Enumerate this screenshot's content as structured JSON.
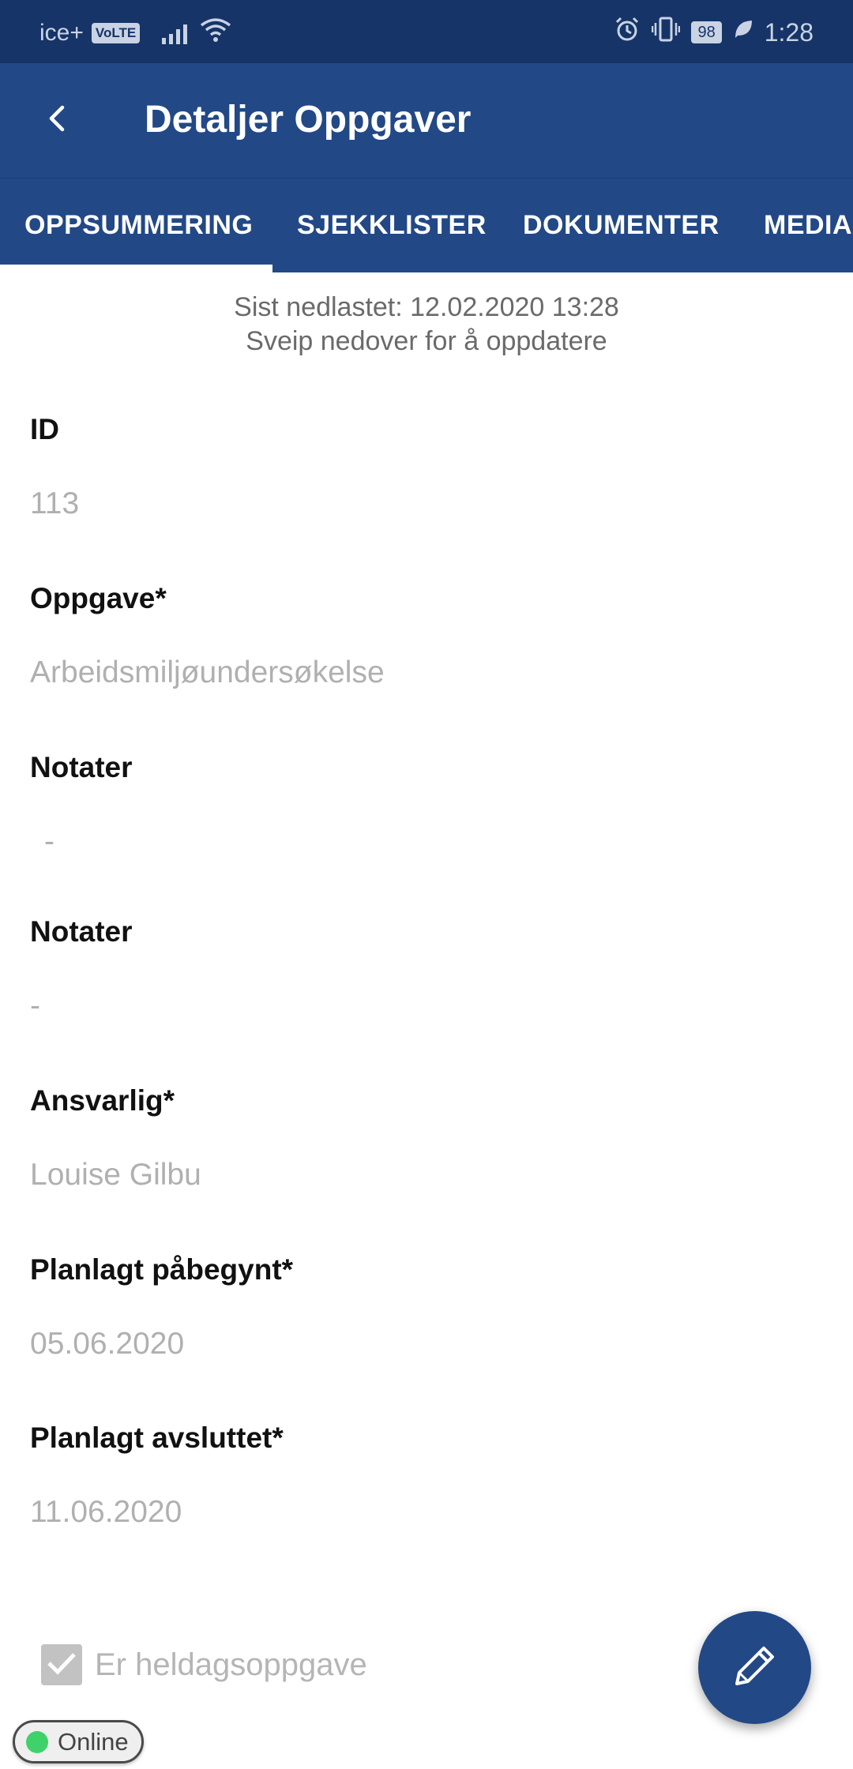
{
  "status_bar": {
    "carrier": "ice+",
    "volte": "VoLTE",
    "battery": "98",
    "time": "1:28"
  },
  "app_bar": {
    "title": "Detaljer Oppgaver"
  },
  "tabs": [
    {
      "label": "OPPSUMMERING",
      "active": true
    },
    {
      "label": "SJEKKLISTER",
      "active": false
    },
    {
      "label": "DOKUMENTER",
      "active": false
    },
    {
      "label": "MEDIA",
      "active": false
    }
  ],
  "refresh": {
    "last_downloaded": "Sist nedlastet: 12.02.2020 13:28",
    "hint": "Sveip nedover for å oppdatere"
  },
  "fields": [
    {
      "label": "ID",
      "value": "113"
    },
    {
      "label": "Oppgave*",
      "value": "Arbeidsmiljøundersøkelse"
    },
    {
      "label": "Notater",
      "value": "-"
    },
    {
      "label": "Notater",
      "value": "-"
    },
    {
      "label": "Ansvarlig*",
      "value": "Louise Gilbu"
    },
    {
      "label": "Planlagt påbegynt*",
      "value": "05.06.2020"
    },
    {
      "label": "Planlagt avsluttet*",
      "value": "11.06.2020"
    }
  ],
  "all_day": {
    "label": "Er heldagsoppgave",
    "checked": true
  },
  "connection": {
    "status": "Online"
  },
  "colors": {
    "status_bar": "#163467",
    "primary": "#224886",
    "online": "#3fd16a"
  },
  "icons": [
    "back-arrow-icon",
    "alarm-icon",
    "vibrate-icon",
    "battery-icon",
    "leaf-icon",
    "signal-icon",
    "wifi-icon",
    "pencil-icon",
    "check-icon"
  ]
}
